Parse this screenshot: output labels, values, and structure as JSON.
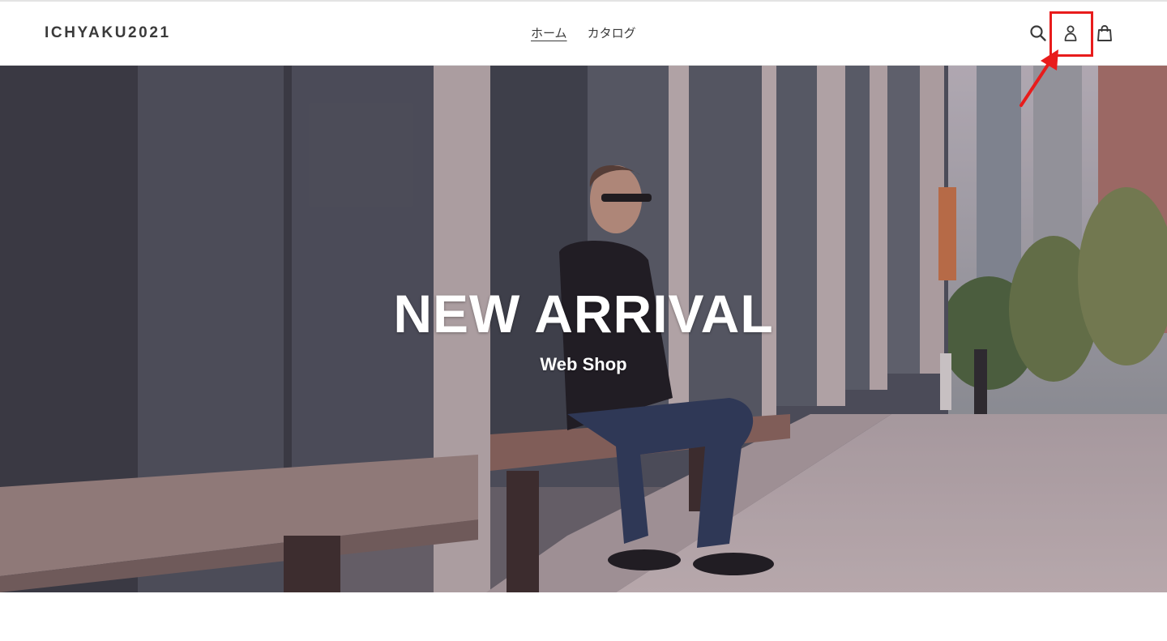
{
  "header": {
    "logo": "ICHYAKU2021",
    "nav": [
      {
        "label": "ホーム",
        "active": true
      },
      {
        "label": "カタログ",
        "active": false
      }
    ],
    "icons": [
      "search-icon",
      "account-icon",
      "cart-icon"
    ]
  },
  "hero": {
    "title": "NEW ARRIVAL",
    "subtitle": "Web Shop"
  },
  "colors": {
    "text": "#3a3a3a",
    "annotation": "#e81c1c",
    "hero_text": "#ffffff"
  }
}
